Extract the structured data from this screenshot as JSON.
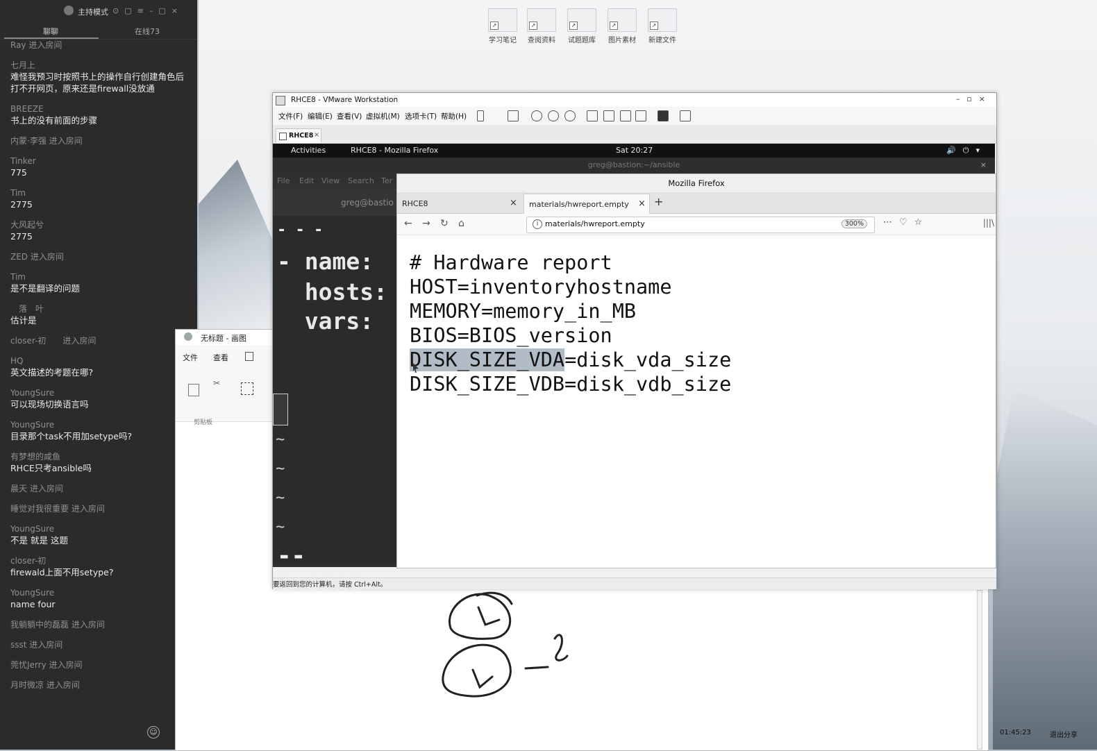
{
  "chat": {
    "header_title": "主持模式",
    "tabs": {
      "chat": "聊聊",
      "online": "在线73"
    },
    "messages": [
      {
        "type": "join",
        "text": "Ray 进入房间"
      },
      {
        "type": "msg",
        "name": "七月上",
        "text": "难怪我预习时按照书上的操作自行创建角色后打不开网页，原来还是firewall没放通"
      },
      {
        "type": "msg",
        "name": "BREEZE",
        "text": "书上的没有前面的步骤"
      },
      {
        "type": "join",
        "text": "内蒙·李强 进入房间"
      },
      {
        "type": "msg",
        "name": "Tinker",
        "text": "775"
      },
      {
        "type": "msg",
        "name": "Tim",
        "text": "2775"
      },
      {
        "type": "msg",
        "name": "大风起兮",
        "text": "2775"
      },
      {
        "type": "join",
        "text": "ZED 进入房间"
      },
      {
        "type": "msg",
        "name": "Tim",
        "text": "是不是翻译的问题"
      },
      {
        "type": "msg",
        "name": "　落　叶",
        "text": "估计是"
      },
      {
        "type": "join",
        "text": "closer-初　　进入房间"
      },
      {
        "type": "msg",
        "name": "HQ",
        "text": "英文描述的考题在哪?"
      },
      {
        "type": "msg",
        "name": "YoungSure",
        "text": "可以现场切换语言吗"
      },
      {
        "type": "msg",
        "name": "YoungSure",
        "text": "目录那个task不用加setype吗?"
      },
      {
        "type": "msg",
        "name": "有梦想的咸鱼",
        "text": "RHCE只考ansible吗"
      },
      {
        "type": "join",
        "text": "晨天 进入房间"
      },
      {
        "type": "join",
        "text": "睡觉对我很重要 进入房间"
      },
      {
        "type": "msg",
        "name": "YoungSure",
        "text": "不是 就是 这题"
      },
      {
        "type": "msg",
        "name": "closer-初",
        "text": "firewald上面不用setype?"
      },
      {
        "type": "msg",
        "name": "YoungSure",
        "text": "name four"
      },
      {
        "type": "join",
        "text": "我躺躺中的磊磊 进入房间"
      },
      {
        "type": "join",
        "text": "ssst 进入房间"
      },
      {
        "type": "join",
        "text": "莞忧Jerry 进入房间"
      },
      {
        "type": "join",
        "text": "月时微凉 进入房间"
      }
    ]
  },
  "desktop_icons": [
    "学习笔记",
    "查阅资料",
    "试题题库",
    "图片素材",
    "新建文件"
  ],
  "paint": {
    "title": "无标题 - 画图",
    "menu_file": "文件",
    "menu_view": "查看",
    "clipboard_label": "剪贴板"
  },
  "vmware": {
    "title": "RHCE8 - VMware Workstation",
    "menus": [
      "文件(F)",
      "编辑(E)",
      "查看(V)",
      "虚拟机(M)",
      "选项卡(T)",
      "帮助(H)"
    ],
    "tab_label": "RHCE8",
    "status_text": "要返回到您的计算机，请按 Ctrl+Alt。"
  },
  "gnome": {
    "activities": "Activities",
    "app_name": "RHCE8 - Mozilla Firefox",
    "clock": "Sat 20:27"
  },
  "terminal": {
    "title": "greg@bastion:~/ansible",
    "menu": [
      "File",
      "Edit",
      "View",
      "Search",
      "Ter"
    ],
    "subtitle": "greg@bastio",
    "lines": [
      "- - -",
      "- name: ",
      "  hosts:",
      "  vars:"
    ],
    "mode": "-- INSERT"
  },
  "firefox": {
    "window_title": "Mozilla Firefox",
    "tabs": [
      "RHCE8",
      "materials/hwreport.empty"
    ],
    "url": "materials/hwreport.empty",
    "zoom": "300%",
    "content_lines": [
      "# Hardware report",
      "HOST=inventoryhostname",
      "MEMORY=memory_in_MB",
      "BIOS=BIOS_version",
      "DISK_SIZE_VDB=disk_vdb_size"
    ],
    "highlight_line": {
      "selected": "DISK_SIZE_VDA",
      "rest": "=disk_vda_size"
    }
  },
  "taskbar": {
    "clock": "01:45:23",
    "share": "退出分享"
  }
}
